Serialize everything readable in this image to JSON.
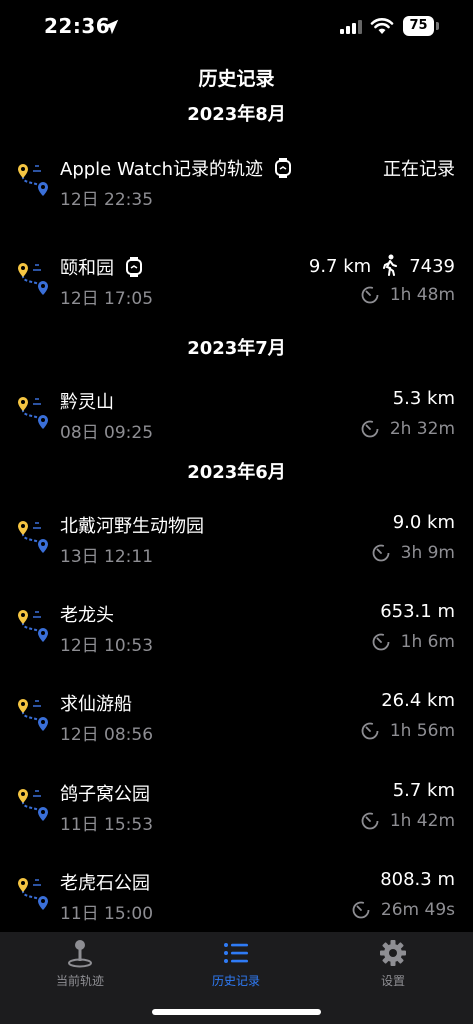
{
  "status": {
    "time": "22:36",
    "battery": "75"
  },
  "page_title": "历史记录",
  "sections": [
    {
      "header": "2023年8月",
      "rows": [
        {
          "name": "Apple Watch记录的轨迹",
          "sub": "12日 22:35",
          "right_top": "正在记录",
          "right_bottom": "",
          "watch": true,
          "steps": ""
        },
        {
          "name": "颐和园",
          "sub": "12日 17:05",
          "right_top": "9.7 km",
          "right_bottom": "1h 48m",
          "watch": true,
          "steps": "7439"
        }
      ]
    },
    {
      "header": "2023年7月",
      "rows": [
        {
          "name": "黔灵山",
          "sub": "08日 09:25",
          "right_top": "5.3 km",
          "right_bottom": "2h 32m"
        }
      ]
    },
    {
      "header": "2023年6月",
      "rows": [
        {
          "name": "北戴河野生动物园",
          "sub": "13日 12:11",
          "right_top": "9.0 km",
          "right_bottom": "3h 9m"
        },
        {
          "name": "老龙头",
          "sub": "12日 10:53",
          "right_top": "653.1 m",
          "right_bottom": "1h 6m"
        },
        {
          "name": "求仙游船",
          "sub": "12日 08:56",
          "right_top": "26.4 km",
          "right_bottom": "1h 56m"
        },
        {
          "name": "鸽子窝公园",
          "sub": "11日 15:53",
          "right_top": "5.7 km",
          "right_bottom": "1h 42m"
        },
        {
          "name": "老虎石公园",
          "sub": "11日 15:00",
          "right_top": "808.3 m",
          "right_bottom": "26m 49s"
        }
      ]
    }
  ],
  "tabs": [
    {
      "label": "当前轨迹",
      "icon": "joystick-pin-icon",
      "active": false
    },
    {
      "label": "历史记录",
      "icon": "list-icon",
      "active": true
    },
    {
      "label": "设置",
      "icon": "gear-icon",
      "active": false
    }
  ],
  "colors": {
    "accent": "#2f7bf6",
    "secondary_text": "#8e8e93",
    "pin_yellow": "#f5c542",
    "pin_blue": "#3a6fd8"
  }
}
